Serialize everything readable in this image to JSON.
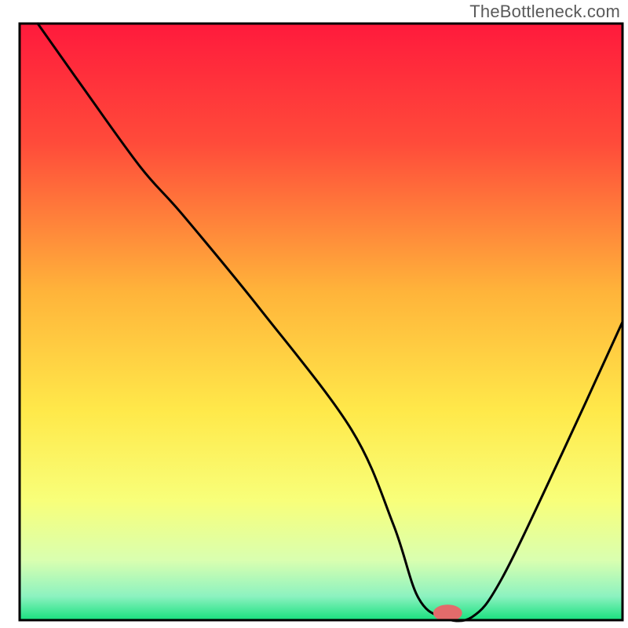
{
  "watermark": "TheBottleneck.com",
  "chart_data": {
    "type": "line",
    "title": "",
    "xlabel": "",
    "ylabel": "",
    "xlim": [
      0,
      100
    ],
    "ylim": [
      0,
      100
    ],
    "grid": false,
    "legend": false,
    "series": [
      {
        "name": "bottleneck-curve",
        "x": [
          3,
          10,
          20,
          27,
          40,
          55,
          62,
          66,
          70,
          75,
          80,
          90,
          100
        ],
        "values": [
          100,
          90,
          76,
          68,
          52,
          32,
          16,
          4,
          0.5,
          0.5,
          7,
          28,
          50
        ]
      }
    ],
    "gradient_stops": [
      {
        "offset": 0,
        "color": "#ff1a3c"
      },
      {
        "offset": 20,
        "color": "#ff4b3a"
      },
      {
        "offset": 45,
        "color": "#ffb43a"
      },
      {
        "offset": 65,
        "color": "#ffe94a"
      },
      {
        "offset": 80,
        "color": "#f8ff7a"
      },
      {
        "offset": 90,
        "color": "#d9ffb0"
      },
      {
        "offset": 96,
        "color": "#8cf2c0"
      },
      {
        "offset": 100,
        "color": "#18e07e"
      }
    ],
    "marker": {
      "x": 71,
      "y": 1.2,
      "color": "#e26b6b",
      "rx": 2.4,
      "ry": 1.4
    }
  }
}
